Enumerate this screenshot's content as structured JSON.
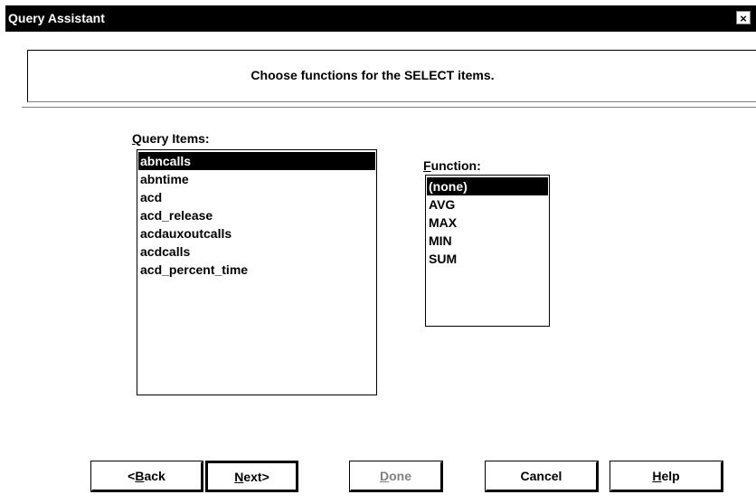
{
  "window": {
    "title": "Query Assistant",
    "close_glyph": "×"
  },
  "header": {
    "instruction": "Choose functions for the SELECT items."
  },
  "query_items": {
    "label_accel": "Q",
    "label_rest": "uery Items:",
    "items": [
      "abncalls",
      "abntime",
      "acd",
      "acd_release",
      "acdauxoutcalls",
      "acdcalls",
      "acd_percent_time"
    ],
    "selected": "abncalls"
  },
  "function": {
    "label_accel": "F",
    "label_rest": "unction:",
    "options": [
      "(none)",
      "AVG",
      "MAX",
      "MIN",
      "SUM"
    ],
    "selected": "(none)"
  },
  "buttons": {
    "back": {
      "pre": "<",
      "accel": "B",
      "post": "ack"
    },
    "next": {
      "pre": "",
      "accel": "N",
      "post": "ext>"
    },
    "done": {
      "pre": "",
      "accel": "D",
      "post": "one"
    },
    "cancel": {
      "label": "Cancel"
    },
    "help": {
      "pre": "",
      "accel": "H",
      "post": "elp"
    }
  }
}
